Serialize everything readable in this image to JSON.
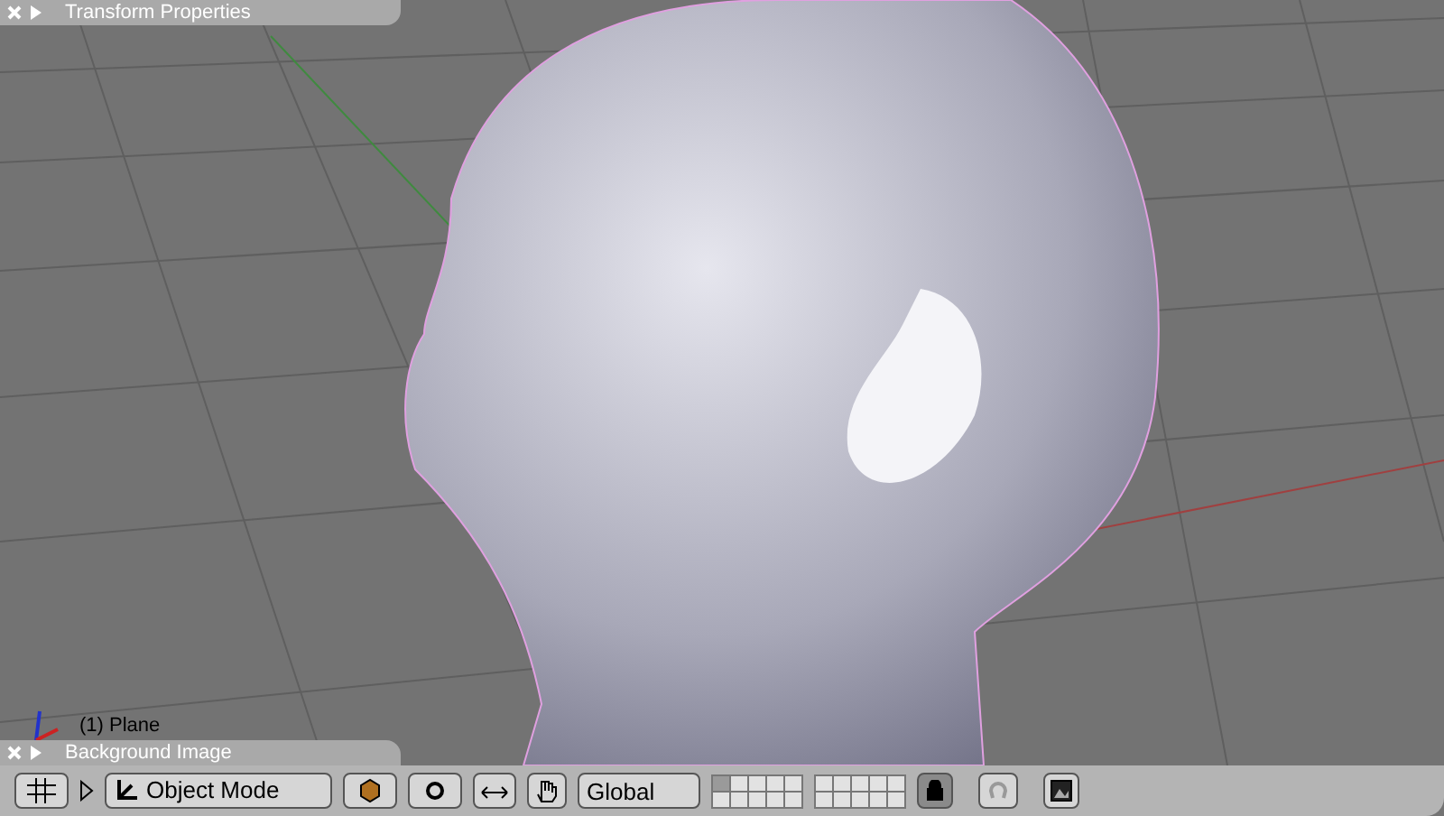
{
  "panels": [
    {
      "title": "Transform Properties"
    },
    {
      "title": "Background Image"
    }
  ],
  "viewport": {
    "object_label": "(1) Plane"
  },
  "header": {
    "mode": "Object Mode",
    "orientation": "Global",
    "lock": {
      "on": true
    },
    "snap": {
      "on": false
    },
    "layers": [
      {
        "selected": true
      },
      {
        "selected": false
      },
      {
        "selected": false
      },
      {
        "selected": false
      },
      {
        "selected": false
      },
      {
        "selected": false
      },
      {
        "selected": false
      },
      {
        "selected": false
      },
      {
        "selected": false
      },
      {
        "selected": false
      },
      {
        "selected": false
      },
      {
        "selected": false
      },
      {
        "selected": false
      },
      {
        "selected": false
      },
      {
        "selected": false
      },
      {
        "selected": false
      },
      {
        "selected": false
      },
      {
        "selected": false
      },
      {
        "selected": false
      },
      {
        "selected": false
      }
    ]
  }
}
